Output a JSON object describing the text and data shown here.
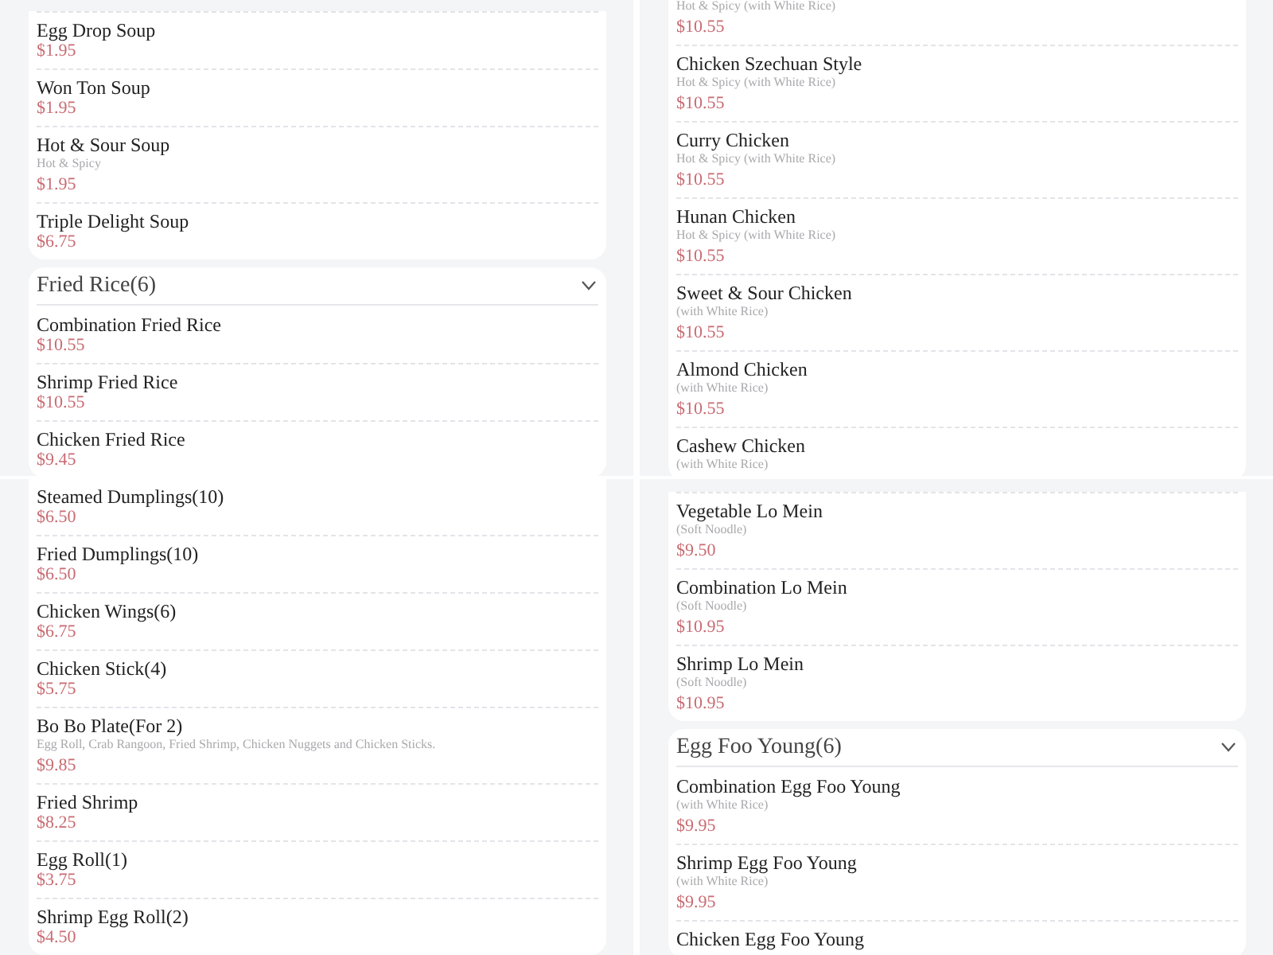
{
  "panels": [
    {
      "sections": [
        {
          "items": [
            {
              "name": "Egg Drop Soup",
              "price": "$1.95"
            },
            {
              "name": "Won Ton Soup",
              "price": "$1.95"
            },
            {
              "name": "Hot & Sour Soup",
              "description": "Hot & Spicy",
              "price": "$1.95"
            },
            {
              "name": "Triple Delight Soup",
              "price": "$6.75"
            }
          ]
        },
        {
          "title": "Fried Rice(6)",
          "expanded": true,
          "items": [
            {
              "name": "Combination Fried Rice",
              "price": "$10.55"
            },
            {
              "name": "Shrimp Fried Rice",
              "price": "$10.55"
            },
            {
              "name": "Chicken Fried Rice",
              "price": "$9.45"
            }
          ]
        }
      ]
    },
    {
      "sections": [
        {
          "items": [
            {
              "description": "Hot & Spicy (with White Rice)",
              "price": "$10.55"
            },
            {
              "name": "Chicken Szechuan Style",
              "description": "Hot & Spicy (with White Rice)",
              "price": "$10.55"
            },
            {
              "name": "Curry Chicken",
              "description": "Hot & Spicy (with White Rice)",
              "price": "$10.55"
            },
            {
              "name": "Hunan Chicken",
              "description": "Hot & Spicy (with White Rice)",
              "price": "$10.55"
            },
            {
              "name": "Sweet & Sour Chicken",
              "description": "(with White Rice)",
              "price": "$10.55"
            },
            {
              "name": "Almond Chicken",
              "description": "(with White Rice)",
              "price": "$10.55"
            },
            {
              "name": "Cashew Chicken",
              "description": "(with White Rice)"
            }
          ]
        }
      ]
    },
    {
      "sections": [
        {
          "items": [
            {
              "name": "Steamed Dumplings(10)",
              "price": "$6.50"
            },
            {
              "name": "Fried Dumplings(10)",
              "price": "$6.50"
            },
            {
              "name": "Chicken Wings(6)",
              "price": "$6.75"
            },
            {
              "name": "Chicken Stick(4)",
              "price": "$5.75"
            },
            {
              "name": "Bo Bo Plate(For 2)",
              "description": "Egg Roll, Crab Rangoon, Fried Shrimp, Chicken Nuggets and Chicken Sticks.",
              "price": "$9.85"
            },
            {
              "name": "Fried Shrimp",
              "price": "$8.25"
            },
            {
              "name": "Egg Roll(1)",
              "price": "$3.75"
            },
            {
              "name": "Shrimp Egg Roll(2)",
              "price": "$4.50"
            }
          ]
        }
      ]
    },
    {
      "sections": [
        {
          "items": [
            {
              "name": "Vegetable Lo Mein",
              "description": "(Soft Noodle)",
              "price": "$9.50"
            },
            {
              "name": "Combination Lo Mein",
              "description": "(Soft Noodle)",
              "price": "$10.95"
            },
            {
              "name": "Shrimp Lo Mein",
              "description": "(Soft Noodle)",
              "price": "$10.95"
            }
          ]
        },
        {
          "title": "Egg Foo Young(6)",
          "expanded": true,
          "items": [
            {
              "name": "Combination Egg Foo Young",
              "description": "(with White Rice)",
              "price": "$9.95"
            },
            {
              "name": "Shrimp Egg Foo Young",
              "description": "(with White Rice)",
              "price": "$9.95"
            },
            {
              "name": "Chicken Egg Foo Young"
            }
          ]
        }
      ]
    }
  ]
}
